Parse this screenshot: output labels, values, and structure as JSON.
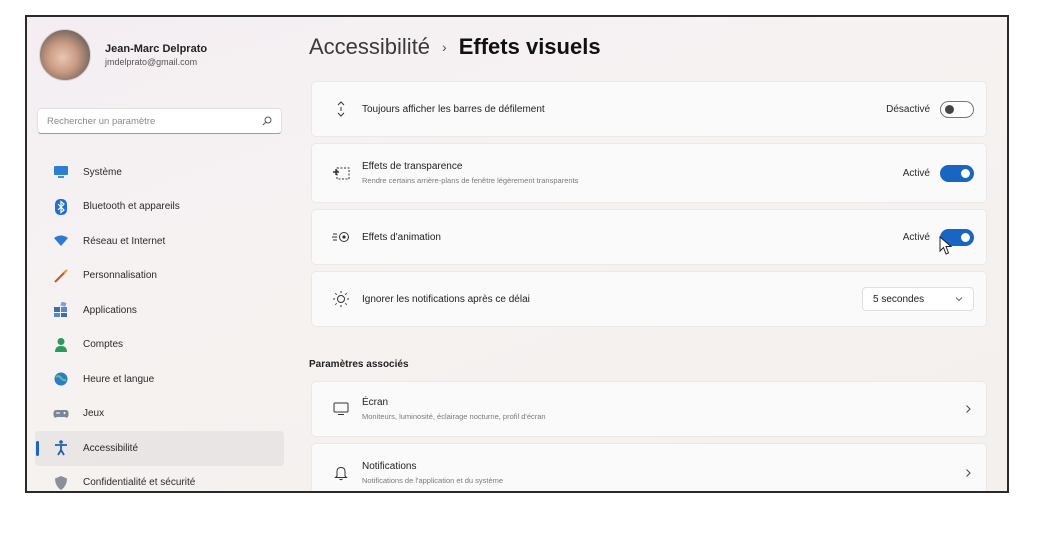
{
  "user": {
    "name": "Jean-Marc Delprato",
    "email": "jmdelprato@gmail.com"
  },
  "search": {
    "placeholder": "Rechercher un paramètre"
  },
  "sidebar": {
    "items": [
      {
        "label": "Système",
        "icon": "monitor-icon"
      },
      {
        "label": "Bluetooth et appareils",
        "icon": "bluetooth-icon"
      },
      {
        "label": "Réseau et Internet",
        "icon": "wifi-icon"
      },
      {
        "label": "Personnalisation",
        "icon": "brush-icon"
      },
      {
        "label": "Applications",
        "icon": "apps-icon"
      },
      {
        "label": "Comptes",
        "icon": "person-icon"
      },
      {
        "label": "Heure et langue",
        "icon": "globe-clock-icon"
      },
      {
        "label": "Jeux",
        "icon": "gamepad-icon"
      },
      {
        "label": "Accessibilité",
        "icon": "accessibility-icon",
        "selected": true
      },
      {
        "label": "Confidentialité et sécurité",
        "icon": "shield-icon"
      }
    ]
  },
  "breadcrumb": {
    "parent": "Accessibilité",
    "separator": "›",
    "current": "Effets visuels"
  },
  "settings": [
    {
      "title": "Toujours afficher les barres de défilement",
      "description": "",
      "state": "Désactivé",
      "toggle_on": false,
      "icon": "scrollbar-icon"
    },
    {
      "title": "Effets de transparence",
      "description": "Rendre certains arrière-plans de fenêtre légèrement transparents",
      "state": "Activé",
      "toggle_on": true,
      "icon": "transparency-icon"
    },
    {
      "title": "Effets d'animation",
      "description": "",
      "state": "Activé",
      "toggle_on": true,
      "icon": "animation-icon"
    },
    {
      "title": "Ignorer les notifications après ce délai",
      "description": "",
      "dropdown_value": "5 secondes",
      "icon": "sun-timer-icon"
    }
  ],
  "related": {
    "heading": "Paramètres associés",
    "items": [
      {
        "title": "Écran",
        "description": "Moniteurs, luminosité, éclairage nocturne, profil d'écran",
        "icon": "display-icon"
      },
      {
        "title": "Notifications",
        "description": "Notifications de l'application et du système",
        "icon": "bell-icon"
      }
    ]
  },
  "colors": {
    "accent": "#1865c4",
    "background": "#f5f0f1",
    "card": "#fbfafa"
  }
}
